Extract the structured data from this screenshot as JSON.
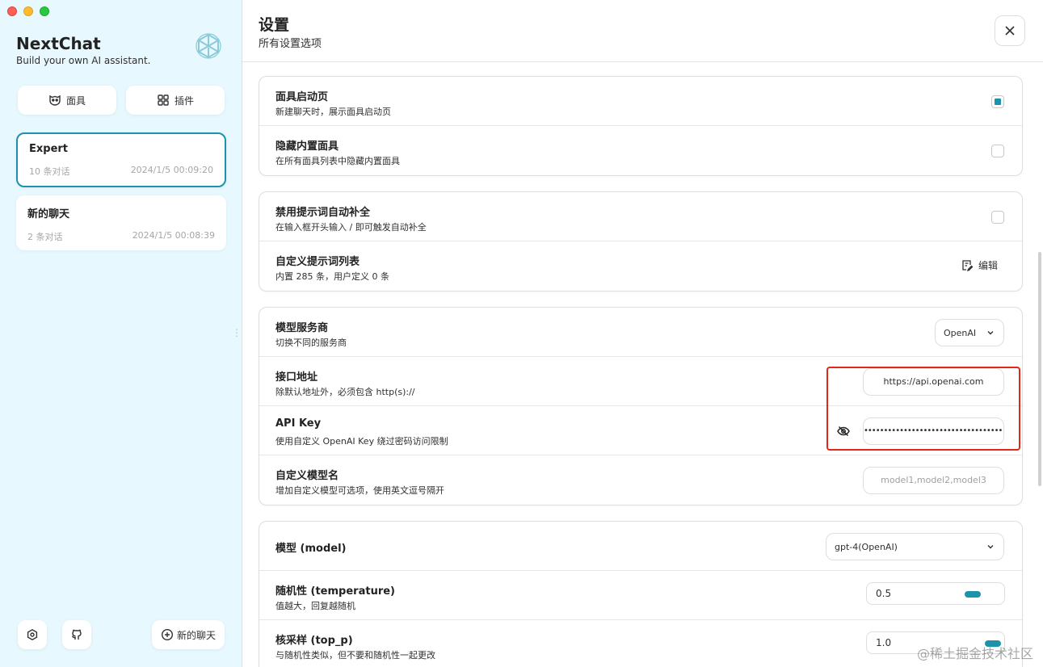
{
  "sidebar": {
    "app_title": "NextChat",
    "app_subtitle": "Build your own AI assistant.",
    "mask_button": "面具",
    "plugin_button": "插件",
    "chats": [
      {
        "title": "Expert",
        "count": "10 条对话",
        "time": "2024/1/5 00:09:20"
      },
      {
        "title": "新的聊天",
        "count": "2 条对话",
        "time": "2024/1/5 00:08:39"
      }
    ],
    "new_chat": "新的聊天"
  },
  "header": {
    "title": "设置",
    "subtitle": "所有设置选项"
  },
  "groups": {
    "mask": {
      "splash": {
        "title": "面具启动页",
        "sub": "新建聊天时，展示面具启动页",
        "checked": true
      },
      "hide_builtin": {
        "title": "隐藏内置面具",
        "sub": "在所有面具列表中隐藏内置面具",
        "checked": false
      }
    },
    "prompt": {
      "disable_autocomplete": {
        "title": "禁用提示词自动补全",
        "sub": "在输入框开头输入 / 即可触发自动补全",
        "checked": false
      },
      "custom_list": {
        "title": "自定义提示词列表",
        "sub": "内置 285 条，用户定义 0 条",
        "edit_label": "编辑"
      }
    },
    "provider": {
      "service": {
        "title": "模型服务商",
        "sub": "切换不同的服务商",
        "value": "OpenAI"
      },
      "endpoint": {
        "title": "接口地址",
        "sub": "除默认地址外，必须包含 http(s)://",
        "value": "https://api.openai.com"
      },
      "api_key": {
        "title": "API Key",
        "sub": "使用自定义 OpenAI Key 绕过密码访问限制",
        "value": "••••••••••••••••••••••••••••••••••••••••••••••••••••"
      },
      "custom_models": {
        "title": "自定义模型名",
        "sub": "增加自定义模型可选项，使用英文逗号隔开",
        "placeholder": "model1,model2,model3"
      }
    },
    "model": {
      "model": {
        "title": "模型 (model)",
        "value": "gpt-4(OpenAI)"
      },
      "temperature": {
        "title": "随机性 (temperature)",
        "sub": "值越大，回复越随机",
        "value": "0.5",
        "fraction": 0.5
      },
      "top_p": {
        "title": "核采样 (top_p)",
        "sub": "与随机性类似，但不要和随机性一起更改",
        "value": "1.0",
        "fraction": 1.0
      }
    }
  },
  "watermark": "@稀土掘金技术社区",
  "colors": {
    "accent": "#1d93ab",
    "highlight": "#e0281a",
    "sidebar_bg": "#e7f8ff"
  }
}
